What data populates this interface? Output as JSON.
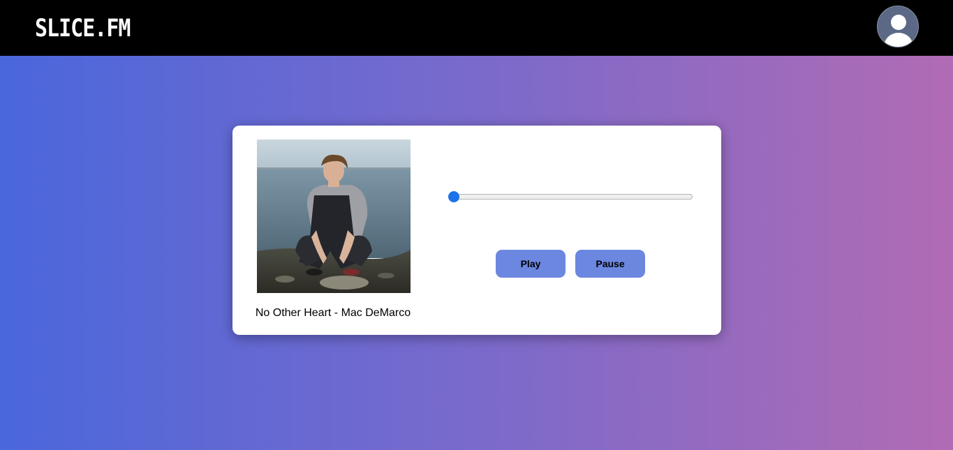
{
  "header": {
    "logo_text": "SLICE.FM",
    "avatar_icon": "user-avatar-icon",
    "background_color": "#000000"
  },
  "player": {
    "track_caption": "No Other Heart - Mac DeMarco",
    "progress": 0,
    "play_label": "Play",
    "pause_label": "Pause",
    "accent_color": "#1a73e8",
    "button_color": "#6b87e0"
  },
  "page": {
    "gradient_start": "#4a67dc",
    "gradient_end": "#b16bb4"
  }
}
